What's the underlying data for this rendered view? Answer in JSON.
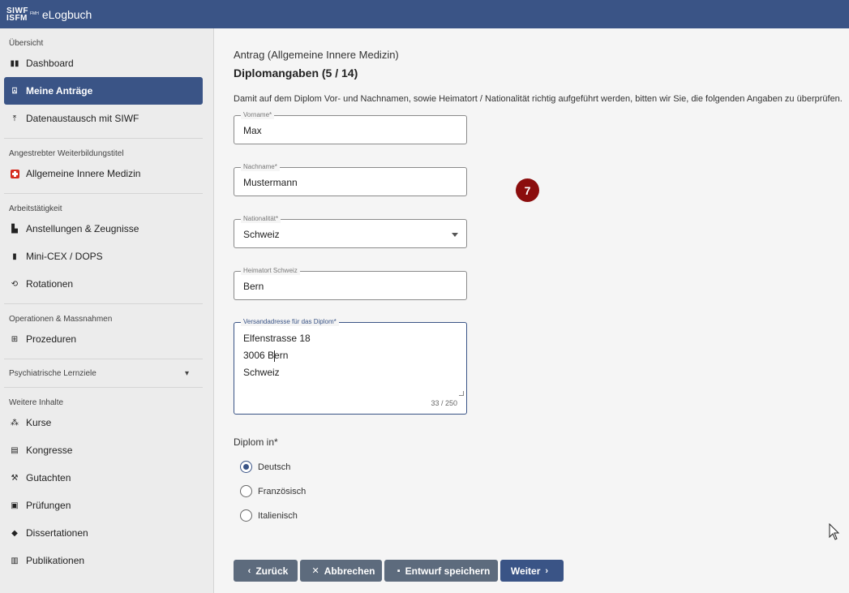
{
  "header": {
    "logo_line1": "SIWF",
    "logo_line2": "ISFM",
    "logo_fmh": "FMH",
    "app_name": "eLogbuch"
  },
  "sidebar": {
    "sections": [
      {
        "title": "Übersicht",
        "items": [
          {
            "label": "Dashboard",
            "icon": "dashboard-icon",
            "active": false
          },
          {
            "label": "Meine Anträge",
            "icon": "stamp-icon",
            "active": true
          },
          {
            "label": "Datenaustausch mit SIWF",
            "icon": "upload-icon",
            "active": false
          }
        ]
      },
      {
        "title": "Angestrebter Weiterbildungstitel",
        "items": [
          {
            "label": "Allgemeine Innere Medizin",
            "icon": "swiss-cross-icon",
            "active": false
          }
        ]
      },
      {
        "title": "Arbeitstätigkeit",
        "items": [
          {
            "label": "Anstellungen & Zeugnisse",
            "icon": "building-icon",
            "active": false
          },
          {
            "label": "Mini-CEX / DOPS",
            "icon": "book-icon",
            "active": false
          },
          {
            "label": "Rotationen",
            "icon": "rotate-icon",
            "active": false
          }
        ]
      },
      {
        "title": "Operationen & Massnahmen",
        "items": [
          {
            "label": "Prozeduren",
            "icon": "plus-square-icon",
            "active": false
          }
        ]
      },
      {
        "title": "Psychiatrische Lernziele",
        "collapsible": true
      },
      {
        "title": "Weitere Inhalte",
        "items": [
          {
            "label": "Kurse",
            "icon": "group-icon",
            "active": false
          },
          {
            "label": "Kongresse",
            "icon": "calendar-icon",
            "active": false
          },
          {
            "label": "Gutachten",
            "icon": "gavel-icon",
            "active": false
          },
          {
            "label": "Prüfungen",
            "icon": "clipboard-icon",
            "active": false
          },
          {
            "label": "Dissertationen",
            "icon": "graduation-cap-icon",
            "active": false
          },
          {
            "label": "Publikationen",
            "icon": "document-icon",
            "active": false
          }
        ]
      }
    ]
  },
  "main": {
    "subtitle": "Antrag (Allgemeine Innere Medizin)",
    "title": "Diplomangaben (5 / 14)",
    "intro": "Damit auf dem Diplom Vor- und Nachnamen, sowie Heimatort / Nationalität richtig aufgeführt werden, bitten wir Sie, die folgenden Angaben zu überprüfen.",
    "fields": {
      "vorname": {
        "label": "Vorname*",
        "value": "Max"
      },
      "nachname": {
        "label": "Nachname*",
        "value": "Mustermann"
      },
      "nationalitaet": {
        "label": "Nationalität*",
        "value": "Schweiz"
      },
      "heimatort": {
        "label": "Heimatort Schweiz",
        "value": "Bern"
      },
      "versandadresse": {
        "label": "Versandadresse für das Diplom*",
        "lines": [
          "Elfenstrasse 18",
          "3006 Bern",
          "Schweiz"
        ],
        "counter": "33 / 250"
      }
    },
    "step_badge": "7",
    "diplom": {
      "label": "Diplom in*",
      "options": [
        {
          "label": "Deutsch",
          "checked": true
        },
        {
          "label": "Französisch",
          "checked": false
        },
        {
          "label": "Italienisch",
          "checked": false
        }
      ]
    },
    "buttons": {
      "back": "Zurück",
      "cancel": "Abbrechen",
      "save_draft": "Entwurf speichern",
      "next": "Weiter"
    }
  },
  "colors": {
    "primary": "#3a5486",
    "secondary_button": "#5d6b7d",
    "badge": "#8b0d0d"
  }
}
